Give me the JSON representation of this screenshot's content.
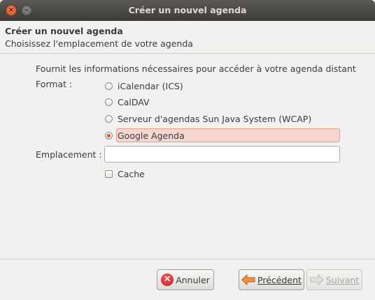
{
  "window": {
    "title": "Créer un nouvel agenda"
  },
  "header": {
    "title": "Créer un nouvel agenda",
    "subtitle": "Choisissez l'emplacement de votre agenda"
  },
  "content": {
    "description": "Fournit les informations nécessaires pour accéder à votre agenda distant",
    "format_label": "Format :",
    "formats": [
      {
        "label": "iCalendar (ICS)",
        "selected": false
      },
      {
        "label": "CalDAV",
        "selected": false
      },
      {
        "label": "Serveur d'agendas Sun Java System (WCAP)",
        "selected": false
      },
      {
        "label": "Google Agenda",
        "selected": true
      }
    ],
    "location_label": "Emplacement :",
    "location_value": "",
    "cache_label": "Cache",
    "cache_checked": false
  },
  "footer": {
    "cancel_label": "Annuler",
    "previous_label": "Précédent",
    "next_label": "Suivant"
  },
  "colors": {
    "accent": "#d65a25",
    "selection": "#f7d6cf"
  }
}
